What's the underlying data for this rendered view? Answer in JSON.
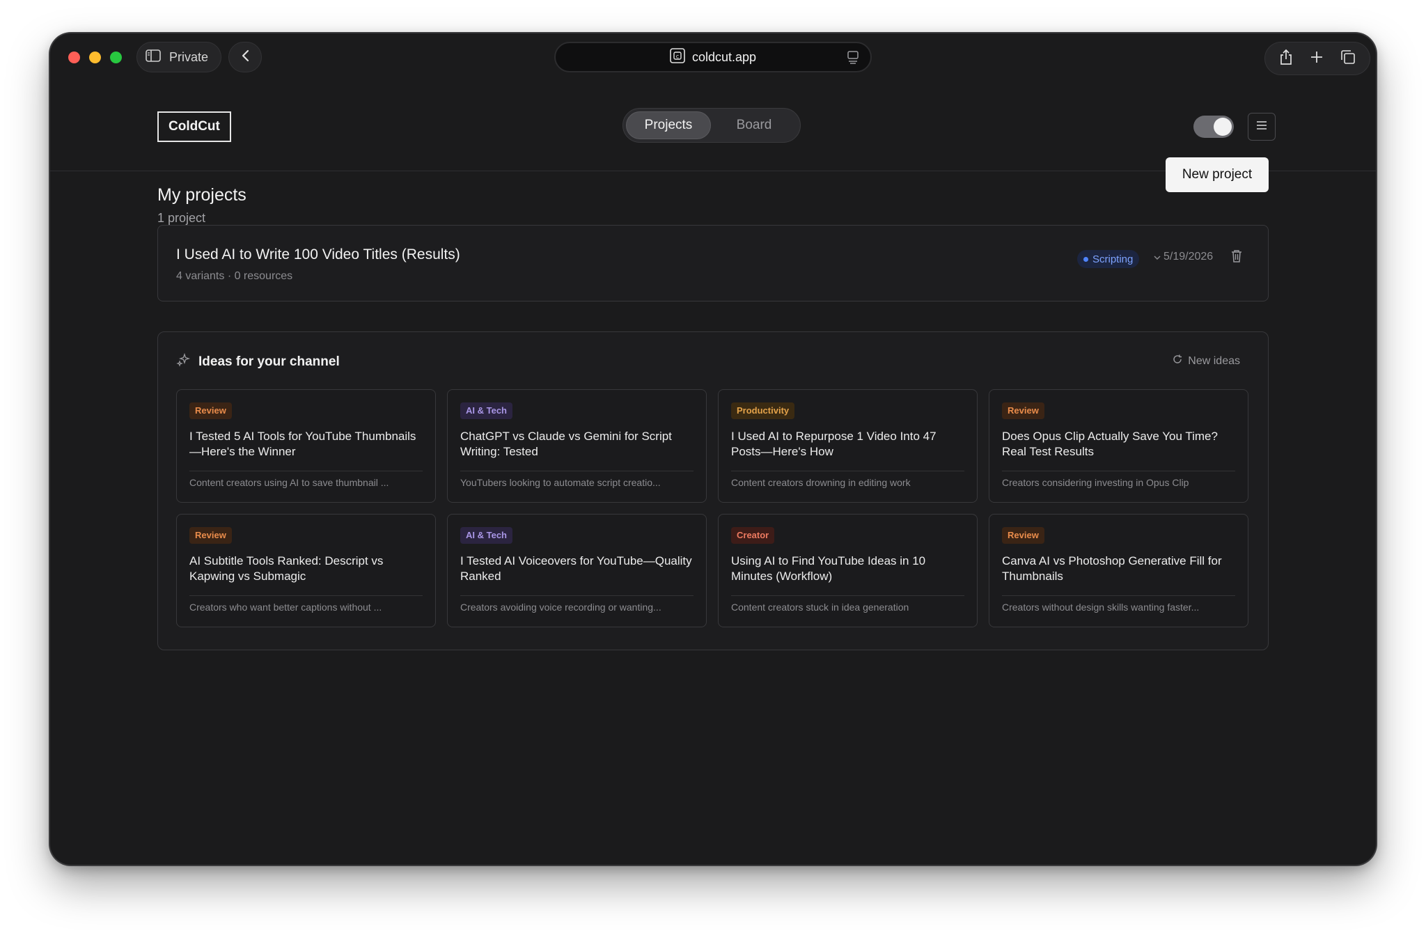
{
  "browser": {
    "private_label": "Private",
    "url": "coldcut.app"
  },
  "header": {
    "logo": "ColdCut",
    "tabs": [
      {
        "label": "Projects",
        "active": true
      },
      {
        "label": "Board",
        "active": false
      }
    ]
  },
  "main": {
    "title": "My projects",
    "subtitle": "1 project",
    "new_project_label": "New project"
  },
  "projects": [
    {
      "title": "I Used AI to Write 100 Video Titles (Results)",
      "meta": "4 variants · 0 resources",
      "status": "Scripting",
      "date": "5/19/2026"
    }
  ],
  "ideas": {
    "heading": "Ideas for your channel",
    "new_ideas_label": "New ideas",
    "cards": [
      {
        "tag": "Review",
        "tag_kind": "review",
        "title": "I Tested 5 AI Tools for YouTube Thumbnails—Here's the Winner",
        "desc": "Content creators using AI to save thumbnail ..."
      },
      {
        "tag": "AI & Tech",
        "tag_kind": "ai",
        "title": "ChatGPT vs Claude vs Gemini for Script Writing: Tested",
        "desc": "YouTubers looking to automate script creatio..."
      },
      {
        "tag": "Productivity",
        "tag_kind": "productivity",
        "title": "I Used AI to Repurpose 1 Video Into 47 Posts—Here's How",
        "desc": "Content creators drowning in editing work"
      },
      {
        "tag": "Review",
        "tag_kind": "review",
        "title": "Does Opus Clip Actually Save You Time? Real Test Results",
        "desc": "Creators considering investing in Opus Clip"
      },
      {
        "tag": "Review",
        "tag_kind": "review",
        "title": "AI Subtitle Tools Ranked: Descript vs Kapwing vs Submagic",
        "desc": "Creators who want better captions without ..."
      },
      {
        "tag": "AI & Tech",
        "tag_kind": "ai",
        "title": "I Tested AI Voiceovers for YouTube—Quality Ranked",
        "desc": "Creators avoiding voice recording or wanting..."
      },
      {
        "tag": "Creator",
        "tag_kind": "creator",
        "title": "Using AI to Find YouTube Ideas in 10 Minutes (Workflow)",
        "desc": "Content creators stuck in idea generation"
      },
      {
        "tag": "Review",
        "tag_kind": "review",
        "title": "Canva AI vs Photoshop Generative Fill for Thumbnails",
        "desc": "Creators without design skills wanting faster..."
      }
    ]
  },
  "colors": {
    "background": "#1b1b1c",
    "accent_status": "#4f84ff",
    "tag_review": "#e98c4b",
    "tag_ai": "#a996e6",
    "tag_productivity": "#e3a24a",
    "tag_creator": "#ec7a60"
  },
  "icons": [
    "sidebar-icon",
    "chevron-left-icon",
    "site-icon",
    "reader-icon",
    "share-icon",
    "plus-icon",
    "tabs-icon",
    "menu-icon",
    "trash-icon",
    "sparkles-icon",
    "refresh-icon",
    "chevron-down-icon"
  ]
}
